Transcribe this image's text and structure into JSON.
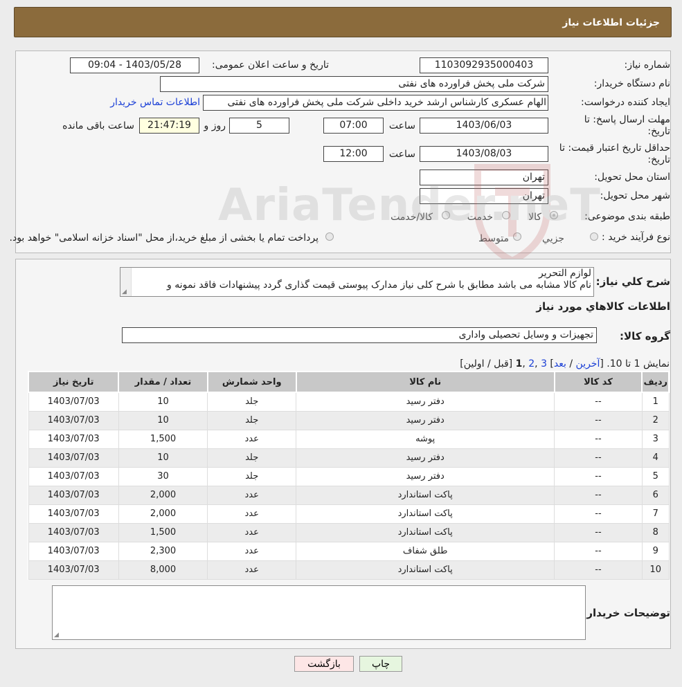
{
  "header": {
    "title": "جزئیات اطلاعات نیاز"
  },
  "form": {
    "need_number_label": "شماره نیاز:",
    "need_number": "1103092935000403",
    "announce_label": "تاریخ و ساعت اعلان عمومی:",
    "announce_value": "1403/05/28 - 09:04",
    "buyer_org_label": "نام دستگاه خریدار:",
    "buyer_org": "شرکت ملی پخش فراورده های نفتی",
    "creator_label": "ایجاد کننده درخواست:",
    "creator": "الهام عسکری کارشناس ارشد خرید داخلی شرکت ملی پخش فراورده های نفتی",
    "contact_link": "اطلاعات تماس خریدار",
    "deadline_label_1": "مهلت ارسال پاسخ: تا",
    "deadline_label_2": "تاریخ:",
    "deadline_date": "1403/06/03",
    "time_label": "ساعت",
    "deadline_time": "07:00",
    "days_value": "5",
    "days_label": "روز و",
    "remaining_time": "21:47:19",
    "remaining_label": "ساعت باقی مانده",
    "validity_label_1": "حداقل تاریخ اعتبار قیمت: تا",
    "validity_label_2": "تاریخ:",
    "validity_date": "1403/08/03",
    "validity_time_label": "ساعت",
    "validity_time": "12:00",
    "province_label": "استان محل تحویل:",
    "province": "تهران",
    "city_label": "شهر محل تحویل:",
    "city": "تهران",
    "category_label": "طبقه بندی موضوعی:",
    "category_options": [
      "کالا",
      "خدمت",
      "کالا/خدمت"
    ],
    "process_label": "نوع فرآیند خرید :",
    "process_options": [
      "جزیي",
      "متوسط"
    ],
    "payment_note": "پرداخت تمام یا بخشی از مبلغ خرید،از محل \"اسناد خزانه اسلامی\" خواهد بود."
  },
  "watermark": {
    "text": "AriaTender.neT"
  },
  "description": {
    "label": "شرح کلي نياز:",
    "lines": [
      "لوازم التحریر",
      "نام کالا مشابه می باشد مطابق با شرح کلی نیاز مدارک پیوستی قیمت گذاری گردد پیشنهادات فاقد نمونه و"
    ]
  },
  "goods": {
    "section_title": "اطلاعات کالاهاي مورد نياز",
    "group_label": "گروه کالا:",
    "group_value": "تجهیزات و وسایل تحصیلی واداری"
  },
  "pager": {
    "summary": "نمایش 1 تا 10.",
    "last": "آخرین",
    "next": "بعد",
    "page3": "3",
    "page2": "2",
    "current": "1",
    "prev_first": "[قبل / اولین]"
  },
  "table": {
    "headers": [
      "ردیف",
      "کد کالا",
      "نام کالا",
      "واحد شمارش",
      "تعداد / مقدار",
      "تاریخ نیاز"
    ],
    "rows": [
      [
        "1",
        "--",
        "دفتر رسید",
        "جلد",
        "10",
        "1403/07/03"
      ],
      [
        "2",
        "--",
        "دفتر رسید",
        "جلد",
        "10",
        "1403/07/03"
      ],
      [
        "3",
        "--",
        "پوشه",
        "عدد",
        "1,500",
        "1403/07/03"
      ],
      [
        "4",
        "--",
        "دفتر رسید",
        "جلد",
        "10",
        "1403/07/03"
      ],
      [
        "5",
        "--",
        "دفتر رسید",
        "جلد",
        "30",
        "1403/07/03"
      ],
      [
        "6",
        "--",
        "پاکت استاندارد",
        "عدد",
        "2,000",
        "1403/07/03"
      ],
      [
        "7",
        "--",
        "پاکت استاندارد",
        "عدد",
        "2,000",
        "1403/07/03"
      ],
      [
        "8",
        "--",
        "پاکت استاندارد",
        "عدد",
        "1,500",
        "1403/07/03"
      ],
      [
        "9",
        "--",
        "طلق شفاف",
        "عدد",
        "2,300",
        "1403/07/03"
      ],
      [
        "10",
        "--",
        "پاکت استاندارد",
        "عدد",
        "8,000",
        "1403/07/03"
      ]
    ]
  },
  "buyer_notes": {
    "label": "توضیحات خریدار:",
    "value": ""
  },
  "buttons": {
    "back": "بازگشت",
    "print": "چاپ"
  }
}
